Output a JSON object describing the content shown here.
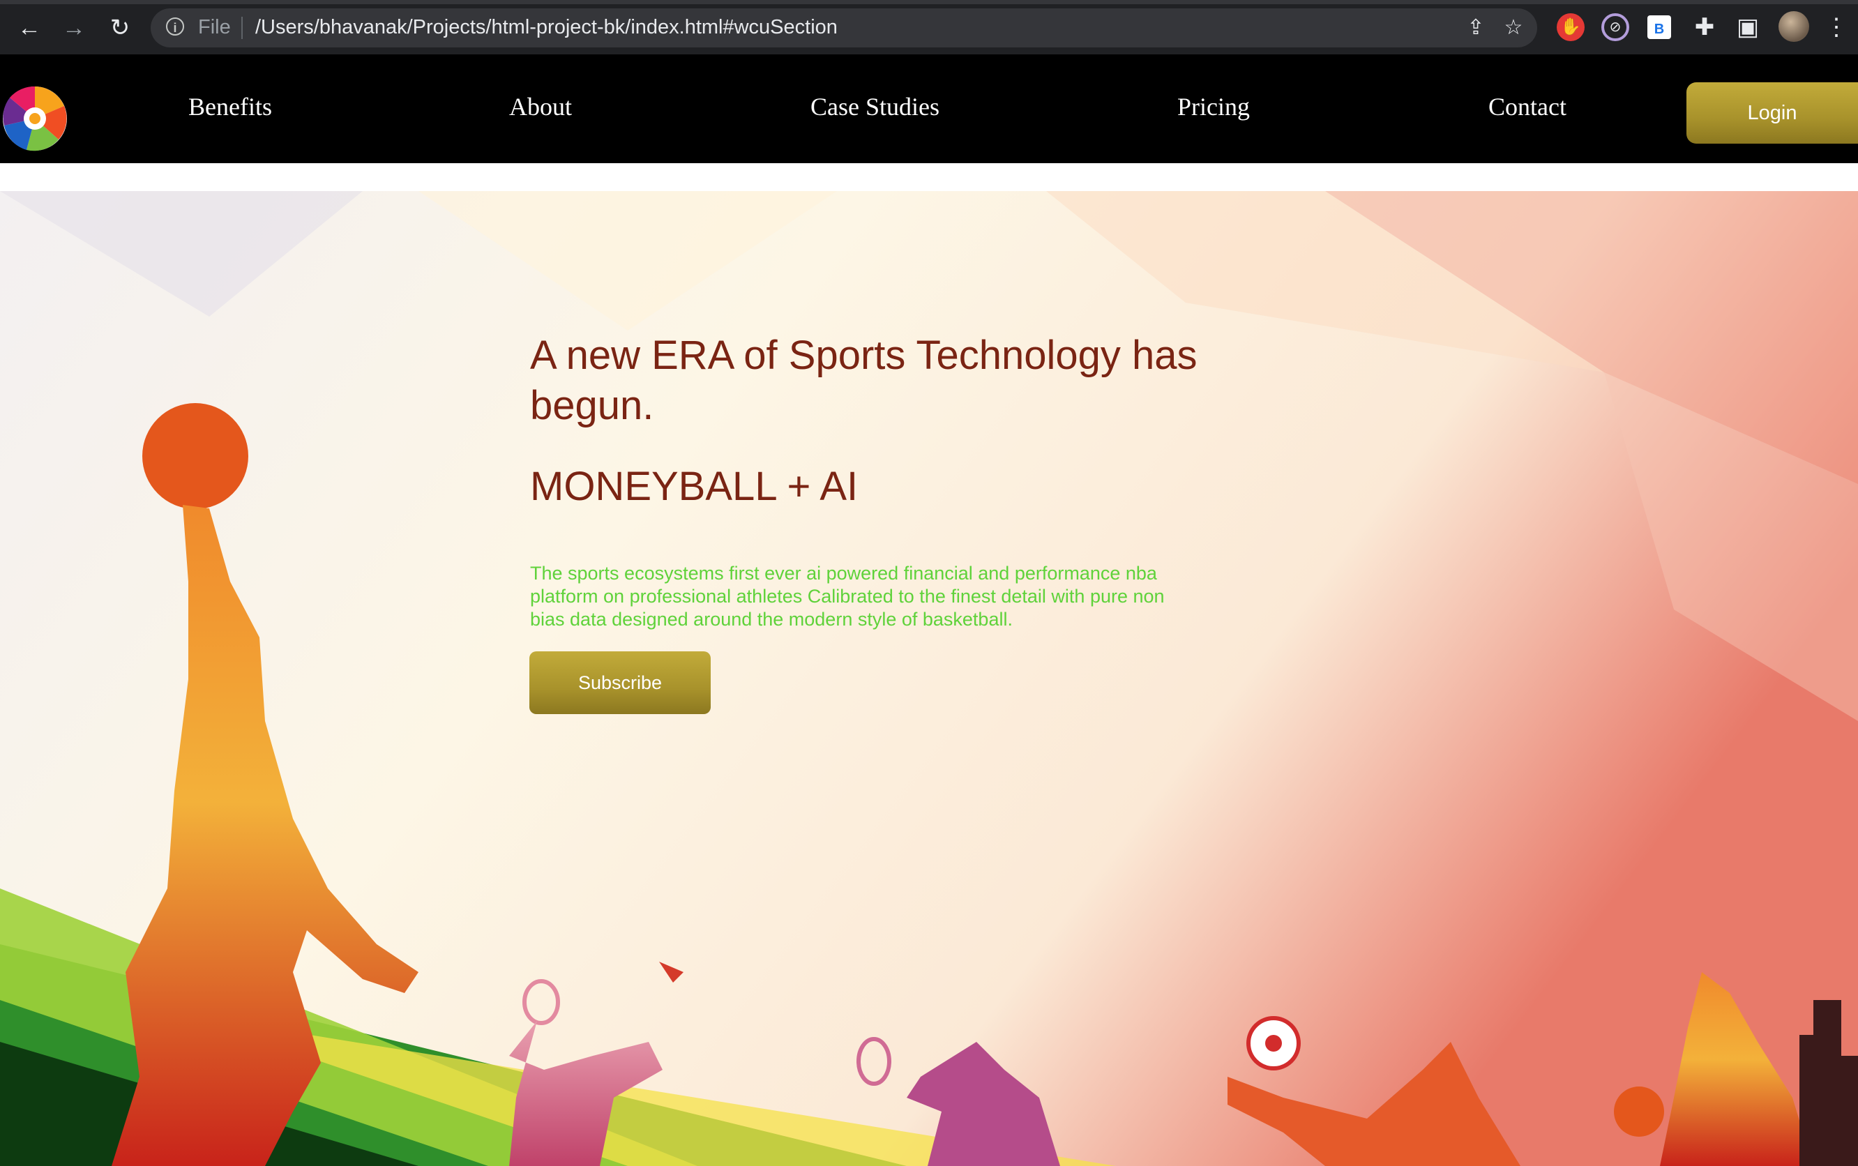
{
  "browser": {
    "file_label": "File",
    "url": "/Users/bhavanak/Projects/html-project-bk/index.html#wcuSection",
    "extension_b_label": "B"
  },
  "site": {
    "nav": {
      "links": [
        "Benefits",
        "About",
        "Case Studies",
        "Pricing",
        "Contact"
      ],
      "login_label": "Login"
    },
    "hero": {
      "title": "A new ERA of Sports Technology has begun.",
      "subtitle": "MONEYBALL + AI",
      "description": "The sports ecosystems first ever ai powered financial and performance nba platform on professional athletes Calibrated to the finest detail with pure non bias data designed around the modern style of basketball.",
      "subscribe_label": "Subscribe"
    }
  },
  "colors": {
    "nav_background": "#000000",
    "button_gold": "#b09a2f",
    "heading": "#7a2413",
    "description": "#5fd23a"
  }
}
